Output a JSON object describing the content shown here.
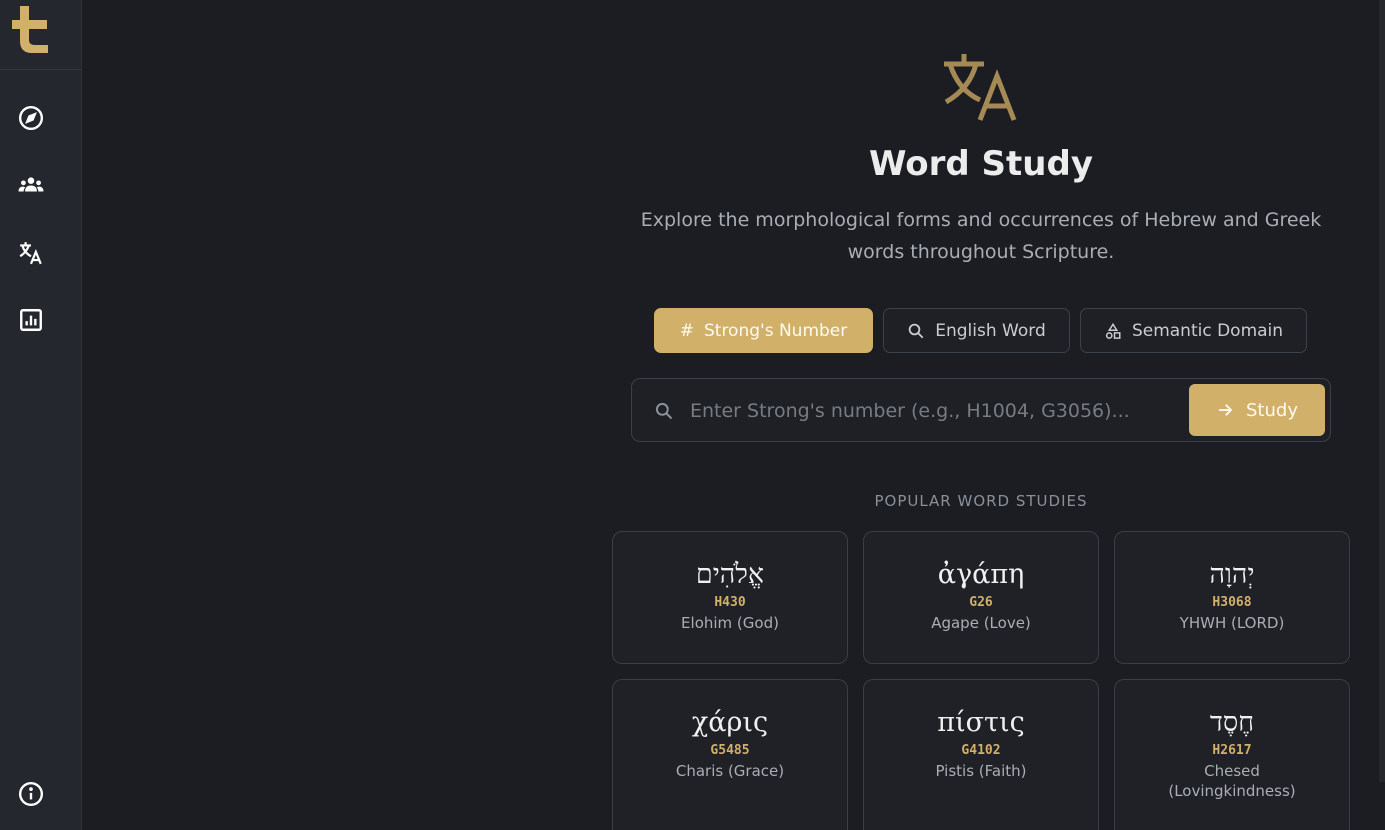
{
  "colors": {
    "accent": "#d1b06a",
    "background": "#1b1d22",
    "sidebar": "#24272d"
  },
  "sidebar": {
    "logo_icon": "cross-logo-icon",
    "items": [
      {
        "icon": "compass-icon",
        "name": "explore"
      },
      {
        "icon": "people-icon",
        "name": "community"
      },
      {
        "icon": "translate-icon",
        "name": "word-study"
      },
      {
        "icon": "chart-icon",
        "name": "analytics"
      }
    ],
    "footer_icon": "info-icon"
  },
  "main": {
    "hero_icon": "translate-icon",
    "title": "Word Study",
    "subtitle": "Explore the morphological forms and occurrences of Hebrew and Greek words throughout Scripture.",
    "tabs": [
      {
        "label": "Strong's Number",
        "icon": "hash-icon",
        "active": true
      },
      {
        "label": "English Word",
        "icon": "search-icon",
        "active": false
      },
      {
        "label": "Semantic Domain",
        "icon": "shapes-icon",
        "active": false
      }
    ],
    "search": {
      "placeholder": "Enter Strong's number (e.g., H1004, G3056)...",
      "value": "",
      "button_label": "Study"
    },
    "popular_label": "POPULAR WORD STUDIES",
    "cards": [
      {
        "word": "אֱלֹהִים",
        "number": "H430",
        "gloss": "Elohim (God)"
      },
      {
        "word": "ἀγάπη",
        "number": "G26",
        "gloss": "Agape (Love)"
      },
      {
        "word": "יְהוָה",
        "number": "H3068",
        "gloss": "YHWH (LORD)"
      },
      {
        "word": "χάρις",
        "number": "G5485",
        "gloss": "Charis (Grace)"
      },
      {
        "word": "πίστις",
        "number": "G4102",
        "gloss": "Pistis (Faith)"
      },
      {
        "word": "חֶסֶד",
        "number": "H2617",
        "gloss": "Chesed (Lovingkindness)"
      }
    ]
  }
}
